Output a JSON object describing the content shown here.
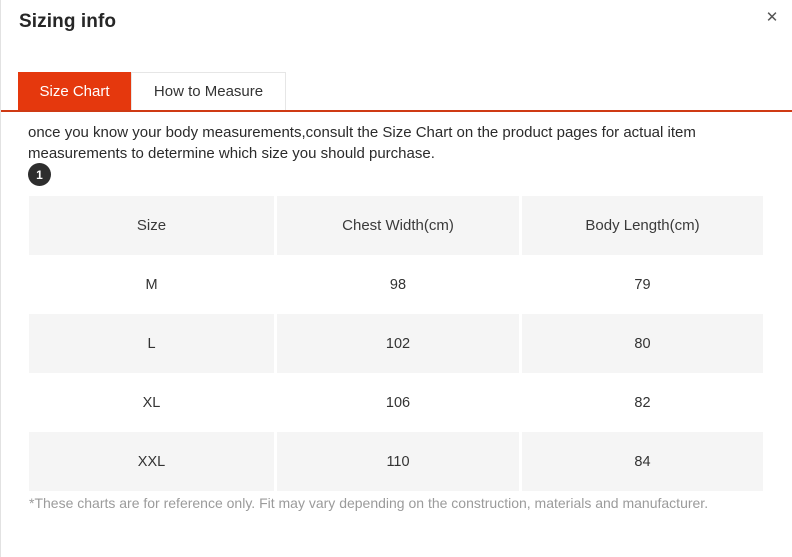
{
  "modal": {
    "title": "Sizing info",
    "close_label": "✕"
  },
  "tabs": [
    {
      "label": "Size Chart",
      "active": true
    },
    {
      "label": "How to Measure",
      "active": false
    }
  ],
  "content": {
    "intro": "once you know your body measurements,consult the Size Chart on the product pages for actual item measurements to determine which size you should purchase.",
    "step_badge": "1",
    "footnote": "*These charts are for reference only. Fit may vary depending on the construction, materials and manufacturer."
  },
  "size_table": {
    "columns": [
      "Size",
      "Chest Width(cm)",
      "Body Length(cm)"
    ],
    "rows": [
      [
        "M",
        "98",
        "79"
      ],
      [
        "L",
        "102",
        "80"
      ],
      [
        "XL",
        "106",
        "82"
      ],
      [
        "XXL",
        "110",
        "84"
      ]
    ]
  },
  "colors": {
    "accent": "#e5380d",
    "accent_line": "#cf3a14",
    "row_shade": "#f5f5f5",
    "badge": "#2e2e2e",
    "footnote_text": "#9b9b9b"
  }
}
